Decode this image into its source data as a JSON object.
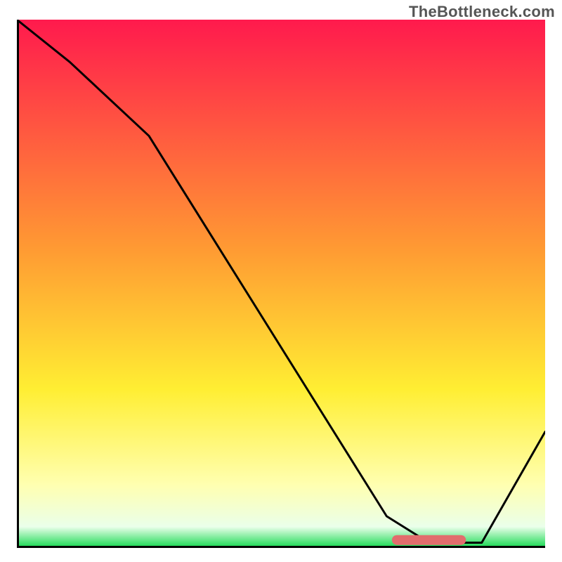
{
  "watermark": {
    "text": "TheBottleneck.com"
  },
  "chart_data": {
    "type": "line",
    "title": "",
    "xlabel": "",
    "ylabel": "",
    "xlim": [
      0,
      100
    ],
    "ylim": [
      0,
      100
    ],
    "grid": false,
    "legend": false,
    "background_gradient_stops": [
      {
        "pos": 0.0,
        "color": "#ff1a4d"
      },
      {
        "pos": 0.43,
        "color": "#ff9933"
      },
      {
        "pos": 0.7,
        "color": "#ffee33"
      },
      {
        "pos": 0.88,
        "color": "#ffffb0"
      },
      {
        "pos": 0.96,
        "color": "#eaffea"
      },
      {
        "pos": 1.0,
        "color": "#12d84e"
      }
    ],
    "series": [
      {
        "name": "bottleneck-curve",
        "color": "#000000",
        "x": [
          0,
          10,
          25,
          70,
          78,
          88,
          100
        ],
        "y": [
          100,
          92,
          78,
          6,
          1,
          1,
          22
        ]
      }
    ],
    "annotations": [
      {
        "name": "optimal-zone-marker",
        "type": "rounded-bar",
        "x_start": 71,
        "x_end": 85,
        "y": 1.5,
        "color": "#e26d6d"
      }
    ]
  }
}
